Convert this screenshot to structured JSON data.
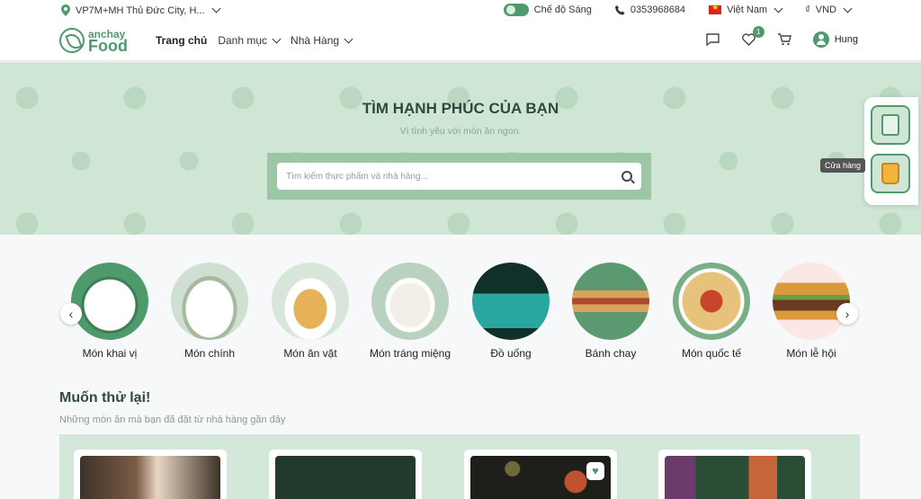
{
  "topbar": {
    "location": "VP7M+MH Thủ Đức City, H...",
    "theme_label": "Chế độ Sáng",
    "phone": "0353968684",
    "language": "Việt Nam",
    "currency_symbol": "₫",
    "currency": "VND"
  },
  "header": {
    "logo_small": "anchay",
    "logo_big": "Food",
    "nav": [
      {
        "label": "Trang chủ"
      },
      {
        "label": "Danh mục"
      },
      {
        "label": "Nhà Hàng"
      }
    ],
    "wishlist_count": "1",
    "user_name": "Hung"
  },
  "hero": {
    "title": "TÌM HẠNH PHÚC CỦA BẠN",
    "subtitle": "Vì tình yêu với món ăn ngon.",
    "search_placeholder": "Tìm kiếm thực phẩm và nhà hàng..."
  },
  "side": {
    "tooltip": "Cửa hàng"
  },
  "categories": [
    {
      "label": "Món khai vị",
      "color": "#4f9a6d"
    },
    {
      "label": "Món chính",
      "color": "#cfe0d2"
    },
    {
      "label": "Món ăn vặt",
      "color": "#d8e6da"
    },
    {
      "label": "Món tráng miệng",
      "color": "#b8d2bf"
    },
    {
      "label": "Đồ uống",
      "color": "#12302a"
    },
    {
      "label": "Bánh chay",
      "color": "#5b9a70"
    },
    {
      "label": "Món quốc tế",
      "color": "#7aae86"
    },
    {
      "label": "Món lễ hội",
      "color": "#fbe7e4"
    }
  ],
  "section": {
    "title": "Muốn thử lại!",
    "subtitle": "Những món ăn mà bạn đã đặt từ nhà hàng gần đây"
  },
  "cards": [
    {
      "color": "#3d3328"
    },
    {
      "color": "#22392e"
    },
    {
      "color": "#1e1e1a"
    },
    {
      "color": "#2b4d35"
    }
  ]
}
